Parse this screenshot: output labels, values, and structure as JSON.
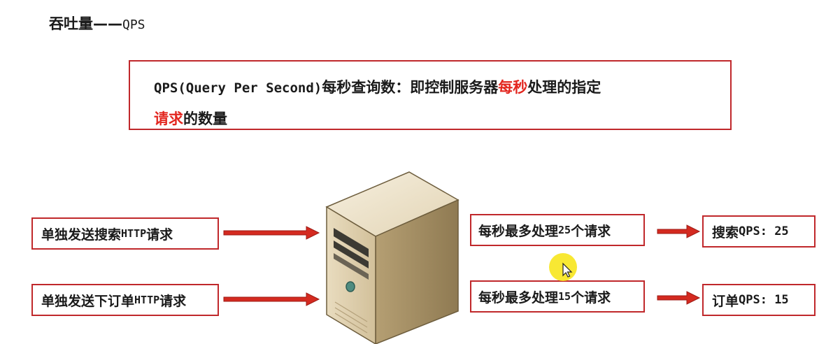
{
  "title": {
    "prefix": "吞吐量——",
    "suffix": "QPS"
  },
  "definition": {
    "term": "QPS(Query Per Second)",
    "part1": "每秒查询数：即控制服务器",
    "highlight1": "每秒",
    "part2": "处理的指定",
    "highlight2": "请求",
    "part3": "的数量"
  },
  "requests": [
    {
      "pre": "单独发送搜索",
      "mono": "HTTP",
      "post": "请求"
    },
    {
      "pre": "单独发送下订单",
      "mono": "HTTP",
      "post": "请求"
    }
  ],
  "capacity": [
    {
      "pre": "每秒最多处理",
      "mono": "25",
      "post": "个请求"
    },
    {
      "pre": "每秒最多处理",
      "mono": "15",
      "post": "个请求"
    }
  ],
  "results": [
    {
      "pre": "搜索",
      "mono": "QPS: 25"
    },
    {
      "pre": "订单",
      "mono": "QPS: 15"
    }
  ],
  "colors": {
    "accent": "#e3261f",
    "border": "#c0282b",
    "cursor_highlight": "#f7e51d"
  },
  "icons": {
    "server": "server-tower-icon",
    "cursor": "mouse-cursor-icon"
  }
}
